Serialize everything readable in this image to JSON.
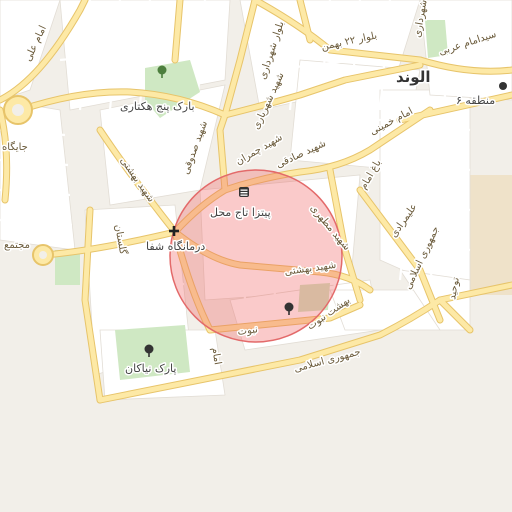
{
  "map": {
    "city_label": "الوند",
    "district_label": "منطقه ۶",
    "search_radius_highlight": true,
    "colors": {
      "land": "#f2efe9",
      "block": "#ffffff",
      "road_major": "#fde9a6",
      "road_major_casing": "#e7c46a",
      "road_minor": "#ffffff",
      "park": "#cfe8c3",
      "circle_fill": "rgba(240,90,90,0.32)",
      "circle_stroke": "#e36a6a",
      "sand_area": "#efe2c9"
    },
    "pois": [
      {
        "id": "park-panj-hektari",
        "label": "بارک پنج هکتاری",
        "icon": "tree-icon"
      },
      {
        "id": "pizza-taj-mahal",
        "label": "پیتزا تاج محل",
        "icon": "restaurant-icon"
      },
      {
        "id": "darmangah-shafa",
        "label": "درمانگاه شفا",
        "icon": "hospital-cross-icon"
      },
      {
        "id": "park-niyakan",
        "label": "پارک نیاکان",
        "icon": "tree-icon"
      },
      {
        "id": "behesht-nobovat",
        "label": "بهشت نبوت",
        "icon": "tree-icon"
      }
    ],
    "streets": {
      "imam_ali": "امام علی",
      "jayegah": "جایگاه",
      "mojtama": "مجتمع",
      "golestan": "گلستان",
      "shahid_beheshti_1": "شهید بهشتی",
      "shahid_beheshti_2": "شهید بهشتی",
      "shahid_sadoughi": "شهید صدوقی",
      "shahid_shahriyari": "شهید شهریاری",
      "shahid_motahari": "شهید مطهری",
      "shahid_chamran": "شهید چمران",
      "shahid_sadeghi": "شهید صادقی",
      "boulevard_shahrdari": "بلوار شهرداری",
      "boulevard_22_bahman": "بلوار ۲۲ بهمن",
      "shahrdari": "شهرداری",
      "imam_khomeini": "امام خمینی",
      "bagh_emam": "باغ امام",
      "seyed_emad_arabi": "سیدامام عربی",
      "jomhouri_eslami_1": "جمهوری اسلامی",
      "jomhouri_eslami_2": "جمهوری اسلامی",
      "nobovat": "نبوت",
      "imam": "امام",
      "tohid": "توحید",
      "alirazi": "علیمرادی",
      "hasan": "بیدار"
    }
  }
}
